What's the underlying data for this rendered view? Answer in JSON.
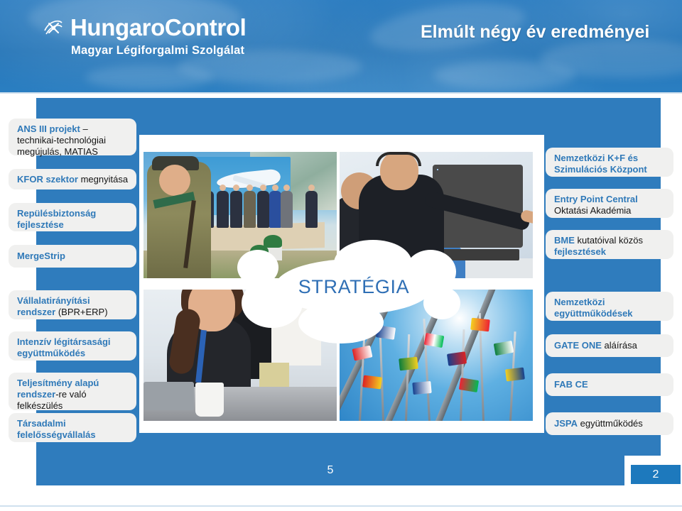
{
  "header": {
    "logo_name": "HungaroControl",
    "logo_subtitle": "Magyar Légiforgalmi Szolgálat",
    "logo_icon": "hungarocontrol-swirl-logo-icon",
    "title": "Elmúlt négy év eredményei"
  },
  "center": {
    "bubble_label": "STRATÉGIA",
    "photos": [
      {
        "name": "ceremony-honor-guard-photo",
        "caption": "Ünnepi ceremónia díszőrrel"
      },
      {
        "name": "radar-simulation-photo",
        "caption": "Radar szimulációs munkaállomás"
      },
      {
        "name": "smiling-employee-office-photo",
        "caption": "Mosolygó munkatárs irodában"
      },
      {
        "name": "international-flags-photo",
        "caption": "Nemzetközi zászlók"
      }
    ]
  },
  "left_column": [
    {
      "name": "card-ans-iii",
      "segments": [
        {
          "text": "ANS III projekt",
          "style": "highlight"
        },
        {
          "text": " – technikai-technológiai megújulás, MATIAS",
          "style": "plain"
        }
      ]
    },
    {
      "name": "card-kfor",
      "segments": [
        {
          "text": "KFOR szektor",
          "style": "highlight"
        },
        {
          "text": " megnyitása",
          "style": "plain"
        }
      ]
    },
    {
      "name": "card-repulesbiztonsag",
      "segments": [
        {
          "text": "Repülésbiztonság fejlesztése",
          "style": "highlight"
        }
      ]
    },
    {
      "name": "card-mergestrip",
      "segments": [
        {
          "text": "MergeStrip",
          "style": "highlight"
        }
      ]
    },
    {
      "name": "card-vallalatiranyitasi",
      "segments": [
        {
          "text": "Vállalatirányítási rendszer",
          "style": "highlight"
        },
        {
          "text": " (BPR+ERP)",
          "style": "plain"
        }
      ]
    },
    {
      "name": "card-legitarsasagi",
      "segments": [
        {
          "text": "Intenzív légitársasági együttműködés",
          "style": "highlight"
        }
      ]
    },
    {
      "name": "card-teljesitmeny",
      "segments": [
        {
          "text": "Teljesítmény alapú rendszer",
          "style": "highlight"
        },
        {
          "text": "-re való felkészülés",
          "style": "plain"
        }
      ]
    },
    {
      "name": "card-tarsadalmi",
      "segments": [
        {
          "text": "Társadalmi felelősségvállalás",
          "style": "highlight"
        }
      ]
    }
  ],
  "right_column": [
    {
      "name": "card-nemzetkozi-kf",
      "segments": [
        {
          "text": "Nemzetközi K+F és Szimulációs Központ",
          "style": "highlight"
        }
      ]
    },
    {
      "name": "card-entry-point-central",
      "segments": [
        {
          "text": "Entry Point Central",
          "style": "highlight"
        },
        {
          "text": " Oktatási Akadémia",
          "style": "plain"
        }
      ]
    },
    {
      "name": "card-bme",
      "segments": [
        {
          "text": "BME",
          "style": "highlight"
        },
        {
          "text": " kutatóival közös ",
          "style": "plain"
        },
        {
          "text": "fejlesztések",
          "style": "highlight"
        }
      ]
    },
    {
      "name": "card-nemzetkozi-egyuttmukodesek",
      "segments": [
        {
          "text": "Nemzetközi együttműködések",
          "style": "highlight"
        }
      ]
    },
    {
      "name": "card-gate-one",
      "segments": [
        {
          "text": "GATE ONE",
          "style": "highlight"
        },
        {
          "text": " aláírása",
          "style": "plain"
        }
      ]
    },
    {
      "name": "card-fab-ce",
      "segments": [
        {
          "text": "FAB CE",
          "style": "highlight"
        }
      ]
    },
    {
      "name": "card-jspa",
      "segments": [
        {
          "text": "JSPA",
          "style": "highlight"
        },
        {
          "text": " együttműködés",
          "style": "plain"
        }
      ]
    }
  ],
  "footer": {
    "slide_number": "5",
    "page_badge": "2"
  },
  "colors": {
    "header_blue": "#2374b7",
    "panel_blue": "#2f7cbd",
    "card_bg": "#f0f0ef",
    "accent_text": "#2f79b8",
    "badge_blue": "#1d79bd"
  }
}
